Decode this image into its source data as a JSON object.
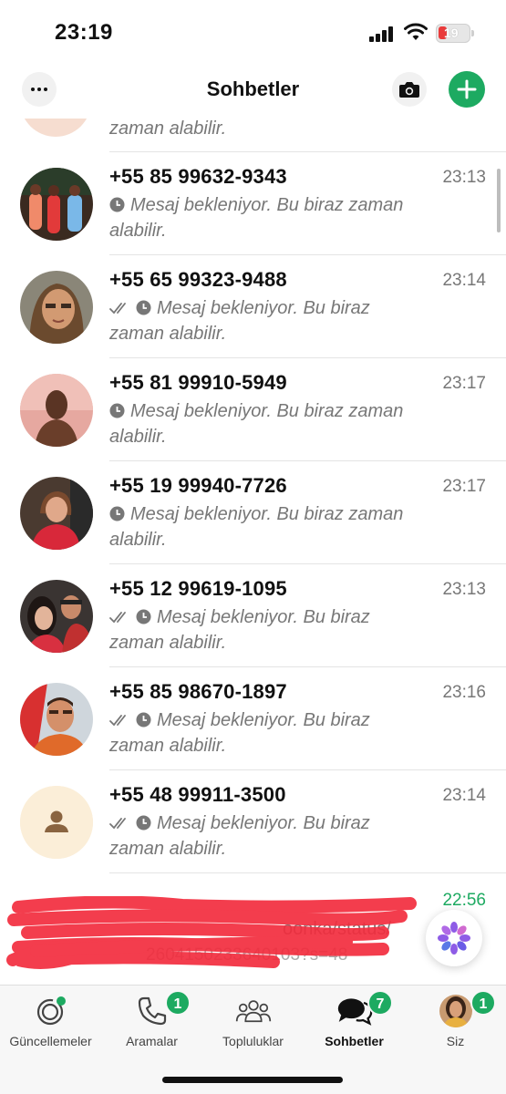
{
  "status_bar": {
    "time": "23:19",
    "battery": "19"
  },
  "header": {
    "title": "Sohbetler"
  },
  "partial_row": {
    "preview": "zaman alabilir."
  },
  "chats": [
    {
      "name": "+55 85 99632-9343",
      "time": "23:13",
      "ticks": false,
      "preview": "Mesaj bekleniyor. Bu biraz zaman alabilir."
    },
    {
      "name": "+55 65 99323-9488",
      "time": "23:14",
      "ticks": true,
      "preview": "Mesaj bekleniyor. Bu biraz zaman alabilir."
    },
    {
      "name": "+55 81 99910-5949",
      "time": "23:17",
      "ticks": false,
      "preview": "Mesaj bekleniyor. Bu biraz zaman alabilir."
    },
    {
      "name": "+55 19 99940-7726",
      "time": "23:17",
      "ticks": false,
      "preview": "Mesaj bekleniyor. Bu biraz zaman alabilir."
    },
    {
      "name": "+55 12 99619-1095",
      "time": "23:13",
      "ticks": true,
      "preview": "Mesaj bekleniyor. Bu biraz zaman alabilir."
    },
    {
      "name": "+55 85 98670-1897",
      "time": "23:16",
      "ticks": true,
      "preview": "Mesaj bekleniyor. Bu biraz zaman alabilir."
    },
    {
      "name": "+55 48 99911-3500",
      "time": "23:14",
      "ticks": true,
      "preview": "Mesaj bekleniyor. Bu biraz zaman alabilir."
    }
  ],
  "obscured_row": {
    "time": "22:56",
    "text1": "oonka/status/",
    "text2": "2604150233640103?s=48"
  },
  "bottom_nav": [
    {
      "label": "Güncellemeler",
      "icon": "updates-icon",
      "badge": ""
    },
    {
      "label": "Aramalar",
      "icon": "phone-icon",
      "badge": "1"
    },
    {
      "label": "Topluluklar",
      "icon": "communities-icon",
      "badge": ""
    },
    {
      "label": "Sohbetler",
      "icon": "chats-icon",
      "badge": "7"
    },
    {
      "label": "Siz",
      "icon": "profile-avatar",
      "badge": "1"
    }
  ],
  "colors": {
    "accent": "#1daa61",
    "muted": "#777777"
  }
}
